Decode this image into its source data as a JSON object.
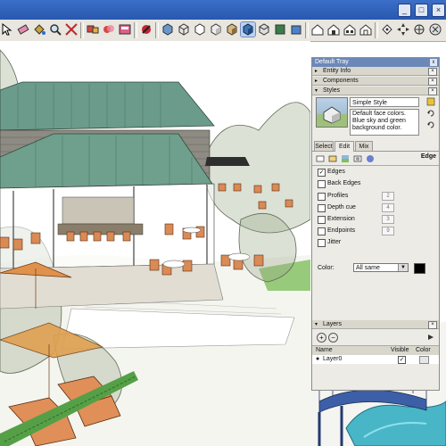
{
  "app": {
    "toolbar_icons": [
      "select-arrow-icon",
      "eraser-icon",
      "paint-bucket-icon",
      "zoom-icon",
      "zoom-extents-icon",
      "previous-view-icon",
      "component-icon",
      "materials-icon",
      "scenes-icon",
      "styles-icon",
      "iso-view-icon",
      "top-view-icon",
      "front-view-icon",
      "right-view-icon",
      "back-view-icon",
      "left-view-icon",
      "xray-icon",
      "wireframe-icon",
      "hidden-line-icon",
      "shaded-icon",
      "shaded-textures-icon",
      "monochrome-icon",
      "orbit-icon",
      "pan-icon",
      "walk-icon",
      "position-camera-icon",
      "look-around-icon",
      "section-plane-icon"
    ]
  },
  "tray": {
    "title": "Default Tray",
    "close": "x",
    "panels": {
      "entity_info": "Entity Info",
      "components": "Components",
      "styles": "Styles"
    },
    "styles": {
      "name": "Simple Style",
      "description": "Default face colors. Blue sky and green background color.",
      "tabs": [
        "Select",
        "Edit",
        "Mix"
      ],
      "selected_tab": "Edit",
      "section_label": "Edge",
      "edge_settings": [
        {
          "label": "Edges",
          "checked": true,
          "value": ""
        },
        {
          "label": "Back Edges",
          "checked": false,
          "value": ""
        },
        {
          "label": "Profiles",
          "checked": false,
          "value": "2"
        },
        {
          "label": "Depth cue",
          "checked": false,
          "value": "4"
        },
        {
          "label": "Extension",
          "checked": false,
          "value": "3"
        },
        {
          "label": "Endpoints",
          "checked": false,
          "value": "9"
        },
        {
          "label": "Jitter",
          "checked": false,
          "value": ""
        }
      ],
      "color_label": "Color:",
      "color_value": "All same",
      "color_swatch": "#000000"
    },
    "layers": {
      "title": "Layers",
      "add": "+",
      "remove": "−",
      "columns": [
        "Name",
        "Visible",
        "Color"
      ],
      "rows": [
        {
          "name": "Layer0",
          "visible": true,
          "active": true
        }
      ]
    }
  },
  "colors": {
    "titlebar": "#2858b0",
    "roof": "#5f8f80",
    "deck_chair": "#d98a55",
    "grass": "#56a045",
    "pool": "#49b6c8"
  }
}
